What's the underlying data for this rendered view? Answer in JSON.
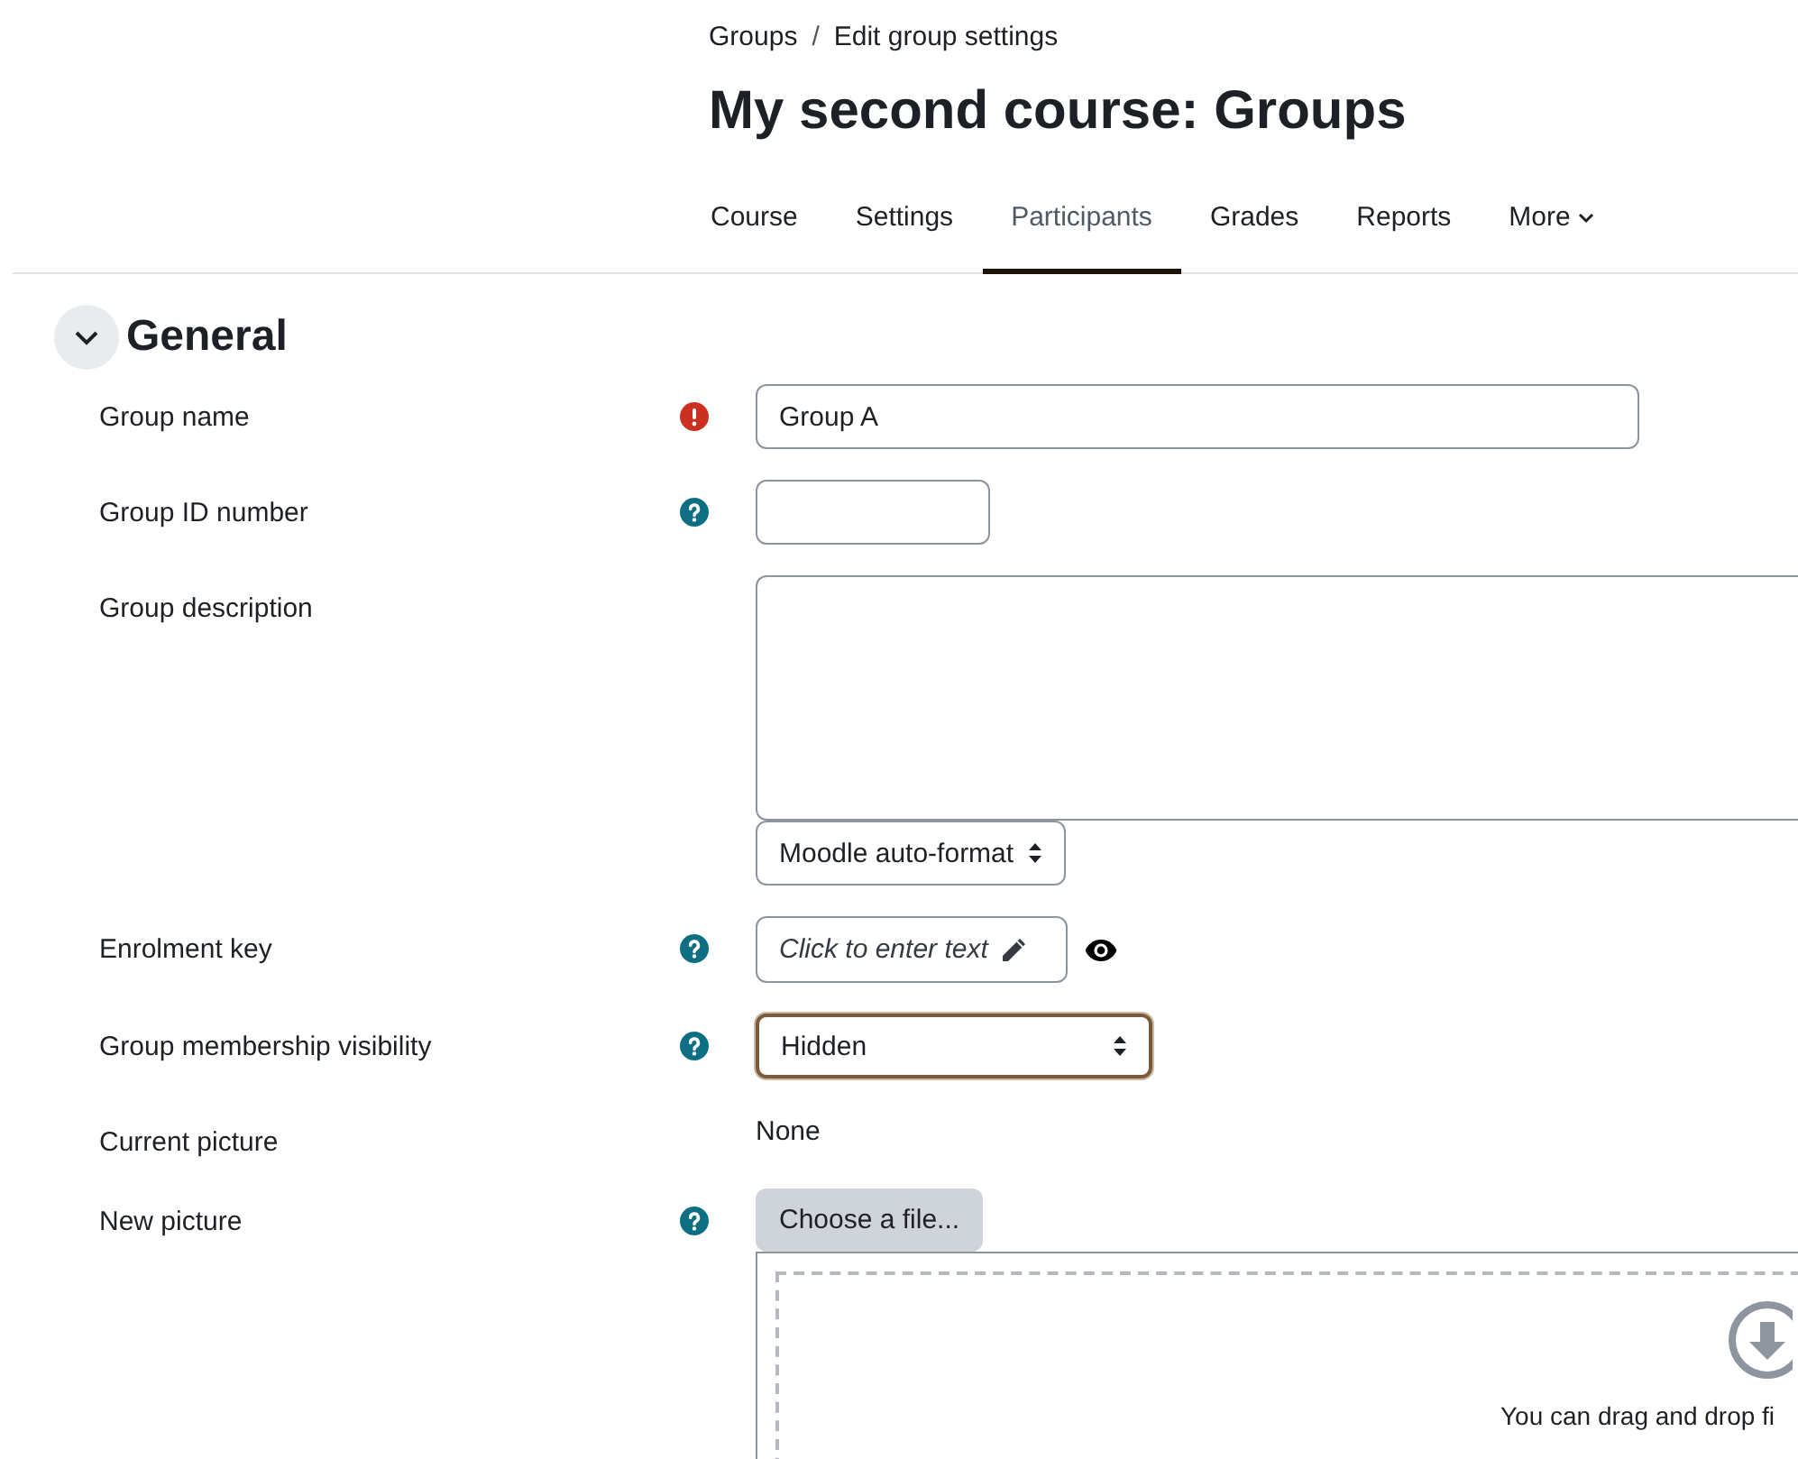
{
  "breadcrumb": {
    "items": [
      {
        "label": "Groups"
      },
      {
        "label": "Edit group settings"
      }
    ],
    "separator": "/"
  },
  "title": "My second course: Groups",
  "tabs": [
    {
      "label": "Course",
      "selected": false,
      "kind": "link"
    },
    {
      "label": "Settings",
      "selected": false,
      "kind": "link"
    },
    {
      "label": "Participants",
      "selected": true,
      "kind": "link"
    },
    {
      "label": "Grades",
      "selected": false,
      "kind": "link"
    },
    {
      "label": "Reports",
      "selected": false,
      "kind": "link"
    },
    {
      "label": "More",
      "selected": false,
      "kind": "menu"
    }
  ],
  "section": {
    "title": "General",
    "expanded": true
  },
  "fields": [
    {
      "label": "Group name",
      "required": true,
      "kind": "text",
      "value": "Group A"
    },
    {
      "label": "Group ID number",
      "help": true,
      "kind": "short-text"
    },
    {
      "label": "Group description",
      "kind": "editor",
      "format": "Moodle auto-format"
    },
    {
      "label": "Enrolment key",
      "help": true,
      "kind": "inline-edit",
      "prompt": "Click to enter text"
    },
    {
      "label": "Group membership visibility",
      "help": true,
      "kind": "select",
      "value": "Hidden",
      "focused": true
    },
    {
      "label": "Current picture",
      "kind": "static",
      "value": "None"
    },
    {
      "label": "New picture",
      "help": true,
      "kind": "filepicker",
      "button": "Choose a file...",
      "drop_text": "You can drag and drop fi"
    }
  ]
}
